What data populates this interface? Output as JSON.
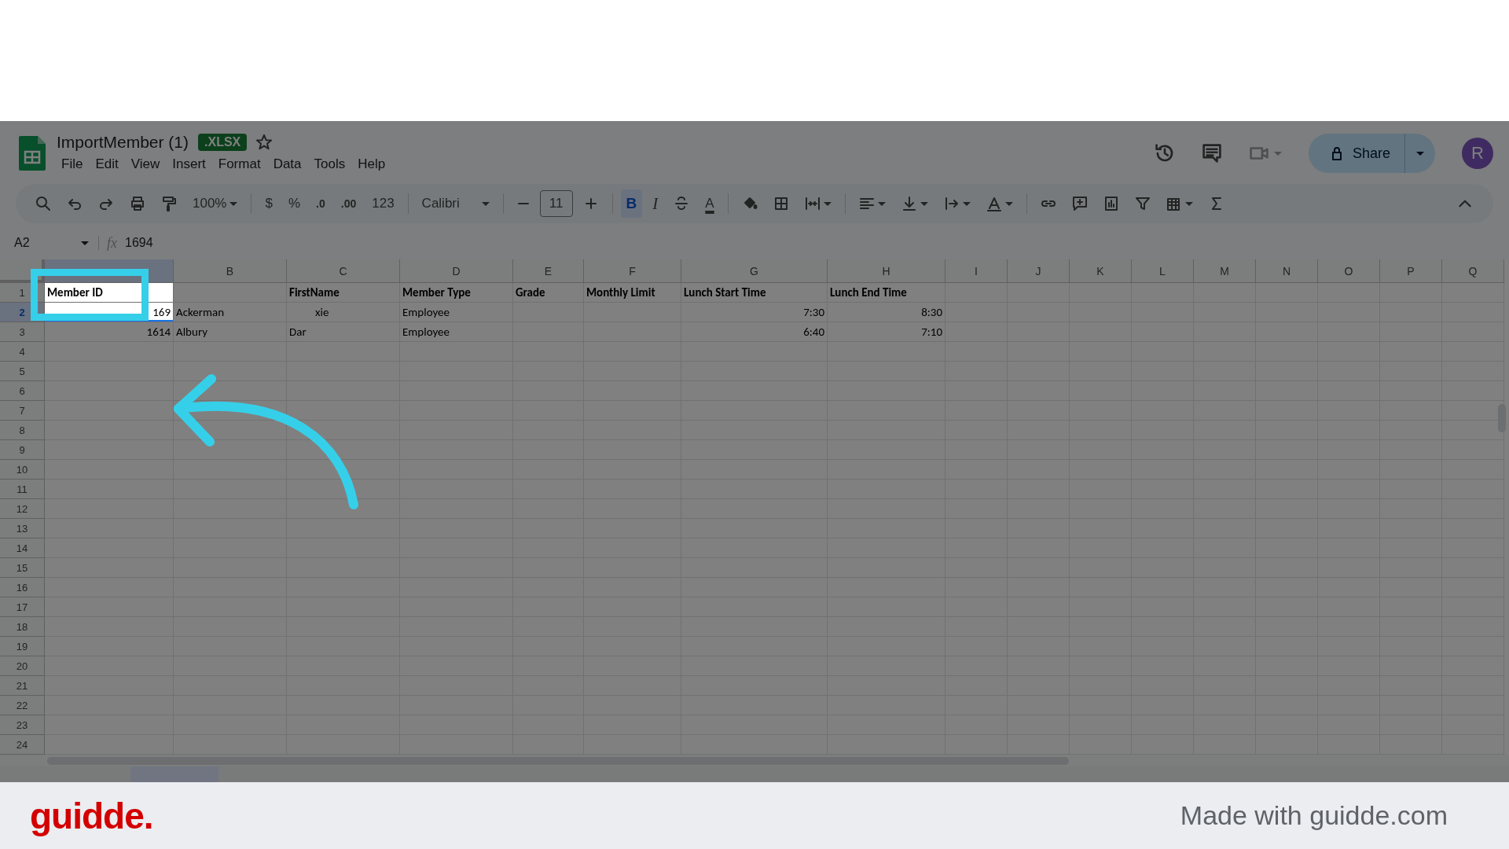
{
  "document": {
    "title": "ImportMember (1)",
    "badge": ".XLSX",
    "menu": [
      "File",
      "Edit",
      "View",
      "Insert",
      "Format",
      "Data",
      "Tools",
      "Help"
    ]
  },
  "header": {
    "share": "Share",
    "avatar": "R"
  },
  "toolbar": [
    {
      "kind": "search"
    },
    {
      "kind": "undo"
    },
    {
      "kind": "redo"
    },
    {
      "kind": "print"
    },
    {
      "kind": "paint"
    },
    {
      "kind": "zoom",
      "text": "100%"
    },
    {
      "kind": "sep"
    },
    {
      "kind": "text",
      "text": "$"
    },
    {
      "kind": "text",
      "text": "%"
    },
    {
      "kind": "decless",
      "text": ".0"
    },
    {
      "kind": "decmore",
      "text": ".00"
    },
    {
      "kind": "text",
      "text": "123"
    },
    {
      "kind": "sep"
    },
    {
      "kind": "font",
      "text": "Calibri"
    },
    {
      "kind": "sep"
    },
    {
      "kind": "minus"
    },
    {
      "kind": "size",
      "text": "11"
    },
    {
      "kind": "plus"
    },
    {
      "kind": "sep"
    },
    {
      "kind": "bold",
      "text": "B",
      "selected": true
    },
    {
      "kind": "italic",
      "text": "I",
      "selected": false
    },
    {
      "kind": "strike"
    },
    {
      "kind": "textcolor",
      "text": "A"
    },
    {
      "kind": "sep"
    },
    {
      "kind": "fill"
    },
    {
      "kind": "borders"
    },
    {
      "kind": "merge"
    },
    {
      "kind": "sep"
    },
    {
      "kind": "align"
    },
    {
      "kind": "valign"
    },
    {
      "kind": "wrap"
    },
    {
      "kind": "rotate"
    },
    {
      "kind": "sep"
    },
    {
      "kind": "link"
    },
    {
      "kind": "comment"
    },
    {
      "kind": "chart"
    },
    {
      "kind": "filter"
    },
    {
      "kind": "table"
    },
    {
      "kind": "sum"
    }
  ],
  "formula_bar": {
    "cell": "A2",
    "fx": "fx",
    "value": "1694"
  },
  "sheet": {
    "columns": [
      {
        "selected": true
      },
      {
        "label": "B",
        "selected": false
      },
      {
        "label": "C",
        "selected": false
      },
      {
        "label": "D",
        "selected": false
      },
      {
        "label": "E",
        "selected": false
      },
      {
        "label": "F",
        "selected": false
      },
      {
        "label": "G",
        "selected": false
      },
      {
        "label": "H",
        "selected": false
      },
      {
        "label": "I",
        "selected": false
      },
      {
        "label": "J",
        "selected": false
      },
      {
        "label": "K",
        "selected": false
      },
      {
        "label": "L",
        "selected": false
      },
      {
        "label": "M",
        "selected": false
      },
      {
        "label": "N",
        "selected": false
      },
      {
        "label": "O",
        "selected": false
      },
      {
        "label": "P",
        "selected": false
      },
      {
        "label": "Q",
        "selected": false
      }
    ],
    "rows": [
      {
        "number": "1",
        "selected": false,
        "cells": [
          {
            "text": "Member ID",
            "bold": true
          },
          null,
          {
            "text": "FirstName",
            "bold": true
          },
          {
            "text": "Member Type",
            "bold": true
          },
          {
            "text": "Grade",
            "bold": true
          },
          {
            "text": "Monthly Limit",
            "bold": true
          },
          {
            "text": "Lunch Start Time",
            "bold": true
          },
          {
            "text": "Lunch End Time",
            "bold": true
          }
        ]
      },
      {
        "number": "2",
        "selected": true,
        "cells": [
          {
            "text": "169",
            "kind": "number"
          },
          "Ackerman",
          {
            "text": "xie",
            "kind": "offset"
          },
          "Employee",
          null,
          null,
          {
            "text": "7:30",
            "kind": "number"
          },
          {
            "text": "8:30",
            "kind": "number"
          }
        ]
      },
      {
        "number": "3",
        "selected": false,
        "cells": [
          {
            "text": "1614",
            "kind": "number"
          },
          "Albury",
          "Dar",
          "Employee",
          null,
          null,
          {
            "text": "6:40",
            "kind": "number"
          },
          {
            "text": "7:10",
            "kind": "number"
          }
        ]
      },
      {
        "number": "4",
        "selected": false
      },
      {
        "number": "5",
        "selected": false
      },
      {
        "number": "6",
        "selected": false
      },
      {
        "number": "7",
        "selected": false
      },
      {
        "number": "8",
        "selected": false
      },
      {
        "number": "9",
        "selected": false
      },
      {
        "number": "10",
        "selected": false
      },
      {
        "number": "11",
        "selected": false
      },
      {
        "number": "12",
        "selected": false
      },
      {
        "number": "13",
        "selected": false
      },
      {
        "number": "14",
        "selected": false
      },
      {
        "number": "15",
        "selected": false
      },
      {
        "number": "16",
        "selected": false
      },
      {
        "number": "17",
        "selected": false
      },
      {
        "number": "18",
        "selected": false
      },
      {
        "number": "19",
        "selected": false
      },
      {
        "number": "20",
        "selected": false
      },
      {
        "number": "21",
        "selected": false
      },
      {
        "number": "22",
        "selected": false
      },
      {
        "number": "23",
        "selected": false
      },
      {
        "number": "24",
        "selected": false
      }
    ]
  },
  "footer": {
    "logo": "guidde.",
    "credit": "Made with guidde.com"
  }
}
